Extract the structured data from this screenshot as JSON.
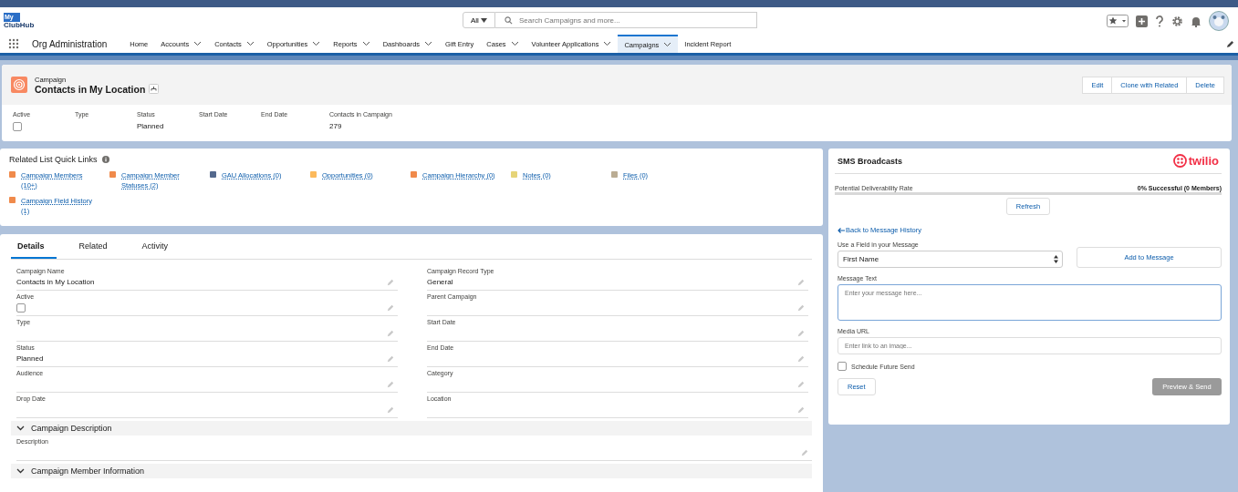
{
  "header": {
    "logo_top": "My",
    "logo_bottom": "ClubHub",
    "search_scope": "All",
    "search_placeholder": "Search Campaigns and more..."
  },
  "nav": {
    "app_name": "Org Administration",
    "items": [
      {
        "label": "Home",
        "has_menu": false,
        "selected": false
      },
      {
        "label": "Accounts",
        "has_menu": true,
        "selected": false
      },
      {
        "label": "Contacts",
        "has_menu": true,
        "selected": false
      },
      {
        "label": "Opportunities",
        "has_menu": true,
        "selected": false
      },
      {
        "label": "Reports",
        "has_menu": true,
        "selected": false
      },
      {
        "label": "Dashboards",
        "has_menu": true,
        "selected": false
      },
      {
        "label": "Gift Entry",
        "has_menu": false,
        "selected": false
      },
      {
        "label": "Cases",
        "has_menu": true,
        "selected": false
      },
      {
        "label": "Volunteer Applications",
        "has_menu": true,
        "selected": false
      },
      {
        "label": "Campaigns",
        "has_menu": true,
        "selected": true
      },
      {
        "label": "Incident Report",
        "has_menu": false,
        "selected": false
      }
    ]
  },
  "record": {
    "object": "Campaign",
    "title": "Contacts in My Location",
    "buttons": [
      "Edit",
      "Clone with Related",
      "Delete"
    ],
    "highlights": [
      {
        "label": "Active",
        "kind": "checkbox",
        "checked": false
      },
      {
        "label": "Type",
        "kind": "text"
      },
      {
        "label": "Status",
        "kind": "text",
        "value": "Planned"
      },
      {
        "label": "Start Date",
        "kind": "text"
      },
      {
        "label": "End Date",
        "kind": "text"
      },
      {
        "label": "Contacts in Campaign",
        "kind": "text",
        "value": "279"
      }
    ]
  },
  "quick_links": {
    "title": "Related List Quick Links",
    "links": [
      {
        "label": "Campaign Members (10+)",
        "color": "#f08a4b"
      },
      {
        "label": "Campaign Member Statuses (2)",
        "color": "#f08a4b"
      },
      {
        "label": "GAU Allocations (0)",
        "color": "#54698d"
      },
      {
        "label": "Opportunities (0)",
        "color": "#fcb95b"
      },
      {
        "label": "Campaign Hierarchy (0)",
        "color": "#f08a4b"
      },
      {
        "label": "Notes (0)",
        "color": "#e6d478"
      },
      {
        "label": "Files (0)",
        "color": "#baac93"
      },
      {
        "label": "Campaign Field History (1)",
        "color": "#f08a4b"
      }
    ]
  },
  "tabs": [
    {
      "label": "Details",
      "selected": true
    },
    {
      "label": "Related",
      "selected": false
    },
    {
      "label": "Activity",
      "selected": false
    }
  ],
  "details": {
    "fields": [
      {
        "label": "Campaign Name",
        "kind": "text",
        "value": "Contacts in My Location"
      },
      {
        "label": "Campaign Record Type",
        "kind": "text",
        "value": "General"
      },
      {
        "label": "Active",
        "kind": "checkbox",
        "checked": false
      },
      {
        "label": "Parent Campaign",
        "kind": "text"
      },
      {
        "label": "Type",
        "kind": "text"
      },
      {
        "label": "Start Date",
        "kind": "text"
      },
      {
        "label": "Status",
        "kind": "text",
        "value": "Planned"
      },
      {
        "label": "End Date",
        "kind": "text"
      },
      {
        "label": "Audience",
        "kind": "text"
      },
      {
        "label": "Category",
        "kind": "text"
      },
      {
        "label": "Drop Date",
        "kind": "text"
      },
      {
        "label": "Location",
        "kind": "text"
      }
    ],
    "sections": [
      {
        "title": "Campaign Description",
        "expanded": true,
        "fields": [
          {
            "label": "Description"
          }
        ]
      },
      {
        "title": "Campaign Member Information",
        "expanded": true
      }
    ]
  },
  "sms": {
    "title": "SMS Broadcasts",
    "brand": "twilio",
    "rate_label": "Potential Deliverability Rate",
    "rate_value": "0% Successful (0 Members)",
    "level": 0,
    "refresh": "Refresh",
    "back_link": "Back to Message History",
    "field_label": "Use a Field in your Message",
    "field_value": "First Name",
    "add_button": "Add to Message",
    "message_label": "Message Text",
    "message_placeholder": "Enter your message here...",
    "media_label": "Media URL",
    "media_placeholder": "Enter link to an image...",
    "schedule_label": "Schedule Future Send",
    "schedule_checked": false,
    "reset": "Reset",
    "send": "Preview & Send",
    "send_disabled": true
  }
}
